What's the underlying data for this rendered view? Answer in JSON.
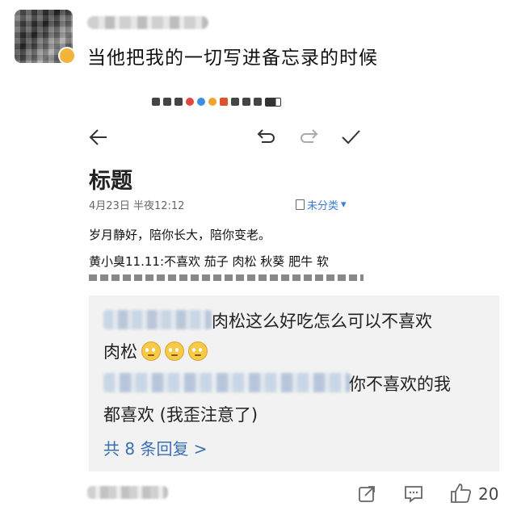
{
  "post": {
    "text": "当他把我的一切写进备忘录的时候"
  },
  "memo": {
    "title": "标题",
    "date": "4月23日 半夜12:12",
    "category": "未分类",
    "line1": "岁月静好，陪你长大，陪你变老。",
    "line2": "黄小臭11.11:不喜欢 茄子 肉松 秋葵 肥牛 软"
  },
  "replies": {
    "reply1_part1": "肉松这么好吃怎么可以不喜欢",
    "reply1_part2": "肉松",
    "reply2_part1": "你不喜欢的我",
    "reply2_part2": "都喜欢 (我歪注意了)",
    "more": "共 8 条回复 >"
  },
  "footer": {
    "like_count": "20"
  },
  "colors": {
    "link": "#3a6fb0",
    "reply_bg": "#f2f2f2",
    "memo_category": "#3a7bd5"
  }
}
